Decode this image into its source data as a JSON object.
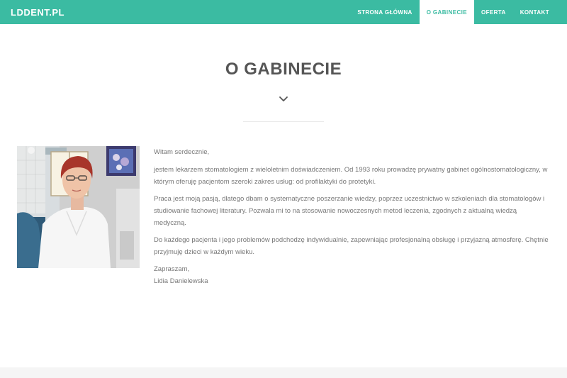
{
  "header": {
    "brand": "LDDENT.PL",
    "nav": [
      {
        "label": "STRONA GŁÓWNA"
      },
      {
        "label": "O GABINECIE"
      },
      {
        "label": "OFERTA"
      },
      {
        "label": "KONTAKT"
      }
    ],
    "active_nav": "O GABINECIE"
  },
  "section": {
    "title": "O GABINECIE",
    "chevron_icon": "chevron-down-icon"
  },
  "photo": {
    "icon": "dentist-portrait-photo"
  },
  "content": {
    "greeting": "Witam serdecznie,",
    "paragraphs": [
      "jestem lekarzem stomatologiem z wieloletnim doświadczeniem. Od 1993 roku prowadzę prywatny gabinet ogólnostomatologiczny, w którym oferuję pacjentom szeroki zakres usług: od profilaktyki do protetyki.",
      "Praca jest moją pasją, dlatego dbam o systematyczne poszerzanie wiedzy, poprzez uczestnictwo w szkoleniach dla stomatologów i studiowanie fachowej literatury. Pozwala mi to na stosowanie nowoczesnych metod leczenia, zgodnych z aktualną wiedzą medyczną.",
      "Do każdego pacjenta i jego problemów podchodzę indywidualnie, zapewniając profesjonalną obsługę i przyjazną atmosferę. Chętnie przyjmuję dzieci w każdym wieku."
    ],
    "closing": "Zapraszam,",
    "signature": "Lidia Danielewska"
  },
  "colors": {
    "accent": "#3bbba2",
    "text": "#777777",
    "title": "#555555"
  }
}
